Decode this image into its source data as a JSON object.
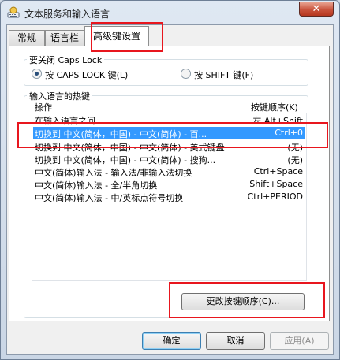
{
  "window": {
    "title": "文本服务和输入语言",
    "close_glyph": "✕"
  },
  "tabs": {
    "general": "常规",
    "language_bar": "语言栏",
    "advanced": "高级键设置"
  },
  "caps_lock": {
    "group_title": "要关闭 Caps Lock",
    "option_caps": "按 CAPS LOCK 键(L)",
    "option_shift": "按 SHIFT 键(F)",
    "selected": "option_caps"
  },
  "hotkeys": {
    "group_title": "输入语言的热键",
    "col_action": "操作",
    "col_sequence": "按键顺序(K)",
    "rows": [
      {
        "action": "在输入语言之间",
        "keys": "左 Alt+Shift"
      },
      {
        "action": "切换到 中文(简体，中国) - 中文(简体) - 百...",
        "keys": "Ctrl+0"
      },
      {
        "action": "切换到 中文(简体，中国) - 中文(简体) - 美式键盘",
        "keys": "(无)"
      },
      {
        "action": "切换到 中文(简体，中国) - 中文(简体) - 搜狗...",
        "keys": "(无)"
      },
      {
        "action": "中文(简体)输入法 - 输入法/非输入法切换",
        "keys": "Ctrl+Space"
      },
      {
        "action": "中文(简体)输入法 - 全/半角切换",
        "keys": "Shift+Space"
      },
      {
        "action": "中文(简体)输入法 - 中/英标点符号切换",
        "keys": "Ctrl+PERIOD"
      }
    ],
    "selected_index": 1,
    "change_button": "更改按键顺序(C)..."
  },
  "footer": {
    "ok": "确定",
    "cancel": "取消",
    "apply": "应用(A)"
  }
}
